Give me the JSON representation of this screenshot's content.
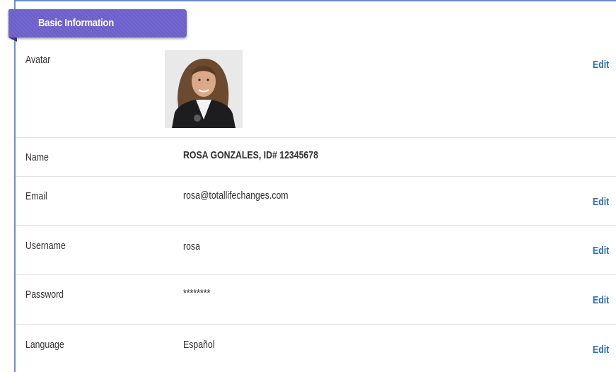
{
  "section": {
    "title": "Basic Information"
  },
  "rows": {
    "avatar": {
      "label": "Avatar",
      "edit": "Edit"
    },
    "name": {
      "label": "Name",
      "value": "ROSA GONZALES, ID# 12345678"
    },
    "email": {
      "label": "Email",
      "value": "rosa@totallifechanges.com",
      "edit": "Edit"
    },
    "username": {
      "label": "Username",
      "value": "rosa",
      "edit": "Edit"
    },
    "password": {
      "label": "Password",
      "value": "********",
      "edit": "Edit"
    },
    "language": {
      "label": "Language",
      "value": "Español",
      "edit": "Edit"
    }
  },
  "colors": {
    "header_bg": "#6b5fcb",
    "edit_link": "#2b6cb8",
    "panel_border": "#6a8fd0"
  }
}
